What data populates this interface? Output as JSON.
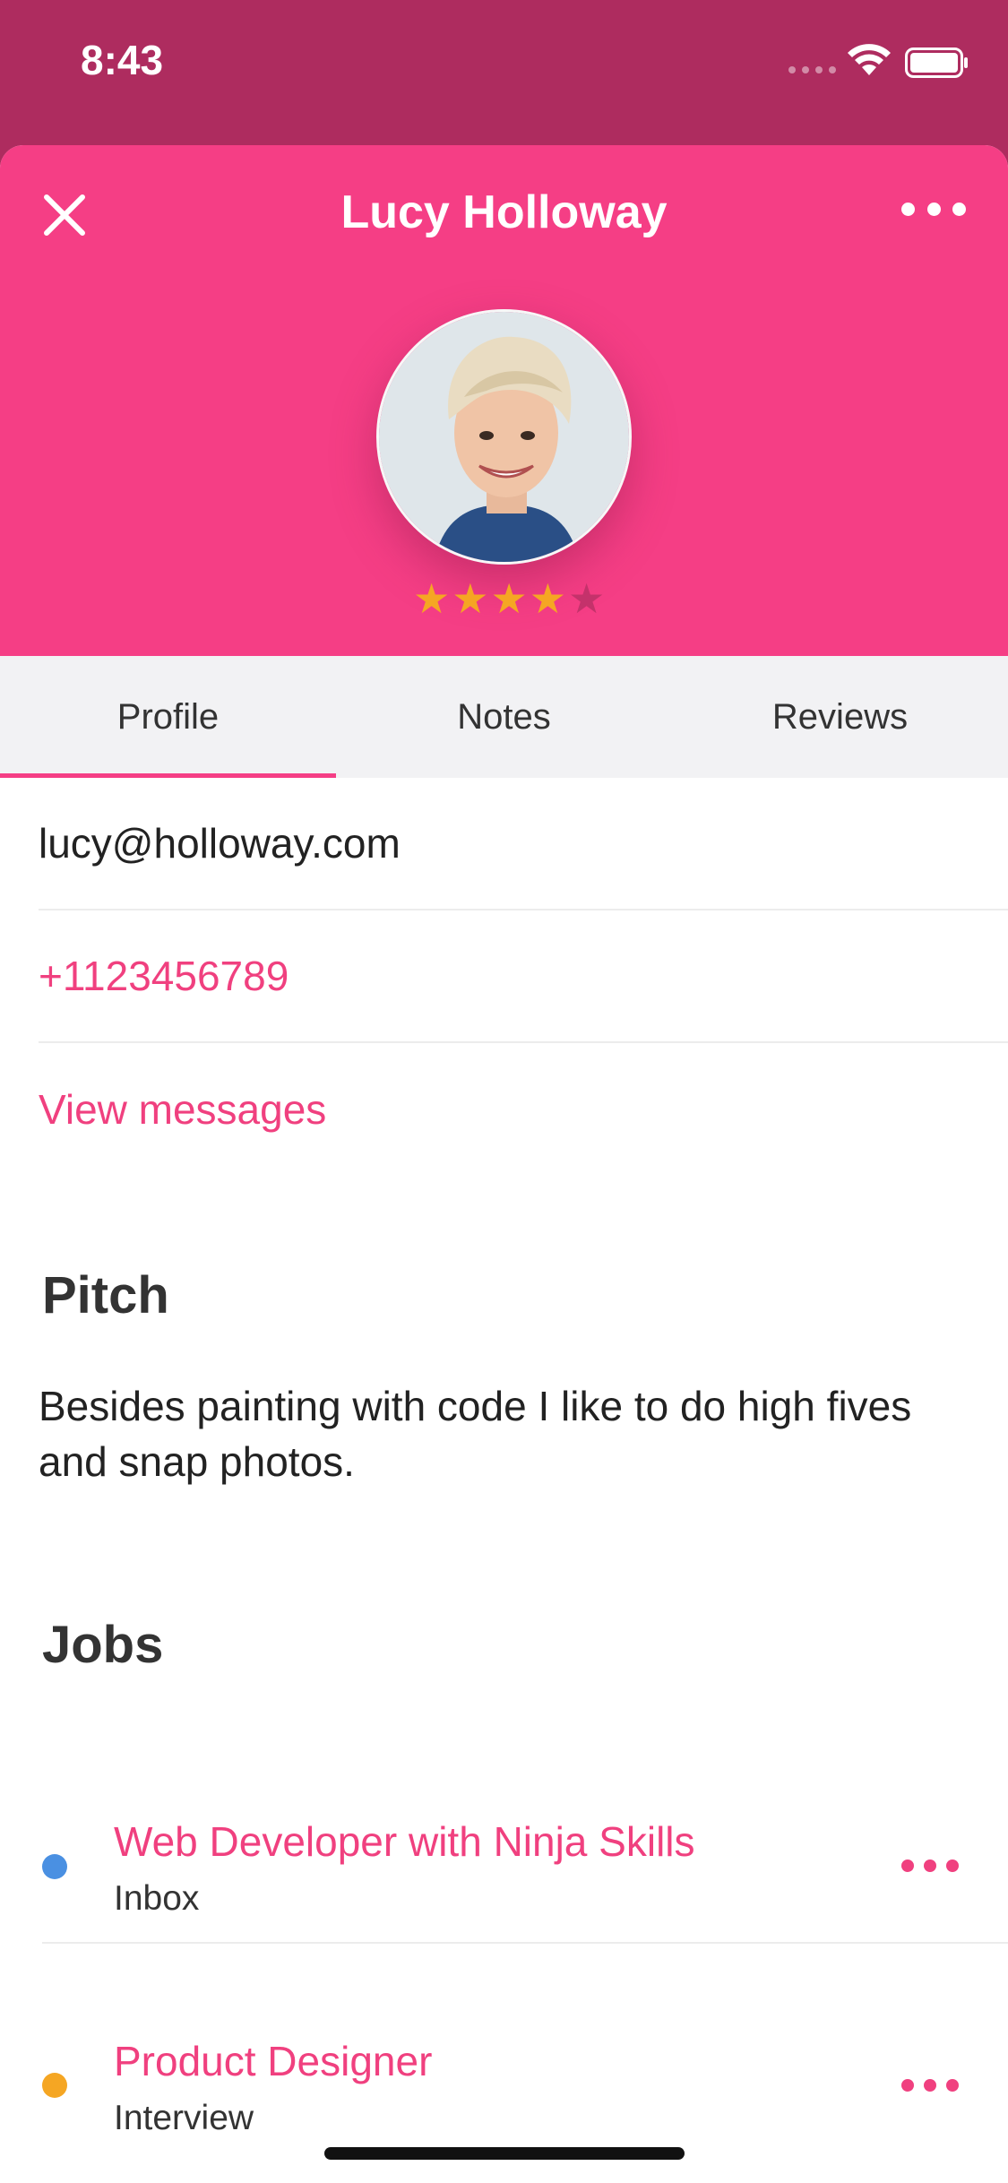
{
  "status_bar": {
    "time": "8:43"
  },
  "header": {
    "title": "Lucy Holloway",
    "rating": {
      "value": 4,
      "max": 5
    },
    "colors": {
      "header_bg": "#f53e85",
      "status_bg": "#ae2c5f",
      "star_on": "#f5a623"
    }
  },
  "tabs": [
    {
      "label": "Profile",
      "active": true
    },
    {
      "label": "Notes",
      "active": false
    },
    {
      "label": "Reviews",
      "active": false
    }
  ],
  "contact": {
    "email": "lucy@holloway.com",
    "phone": "+1123456789",
    "messages_link": "View messages"
  },
  "pitch": {
    "heading": "Pitch",
    "text": "Besides painting with code I like to do high fives and snap photos."
  },
  "jobs": {
    "heading": "Jobs",
    "items": [
      {
        "title": "Web Developer with Ninja Skills",
        "status": "Inbox",
        "dot_color": "#4a90e2"
      },
      {
        "title": "Product Designer",
        "status": "Interview",
        "dot_color": "#f5a623"
      }
    ]
  },
  "icons": [
    "close-icon",
    "more-icon",
    "wifi-icon",
    "battery-icon",
    "star-icon"
  ]
}
